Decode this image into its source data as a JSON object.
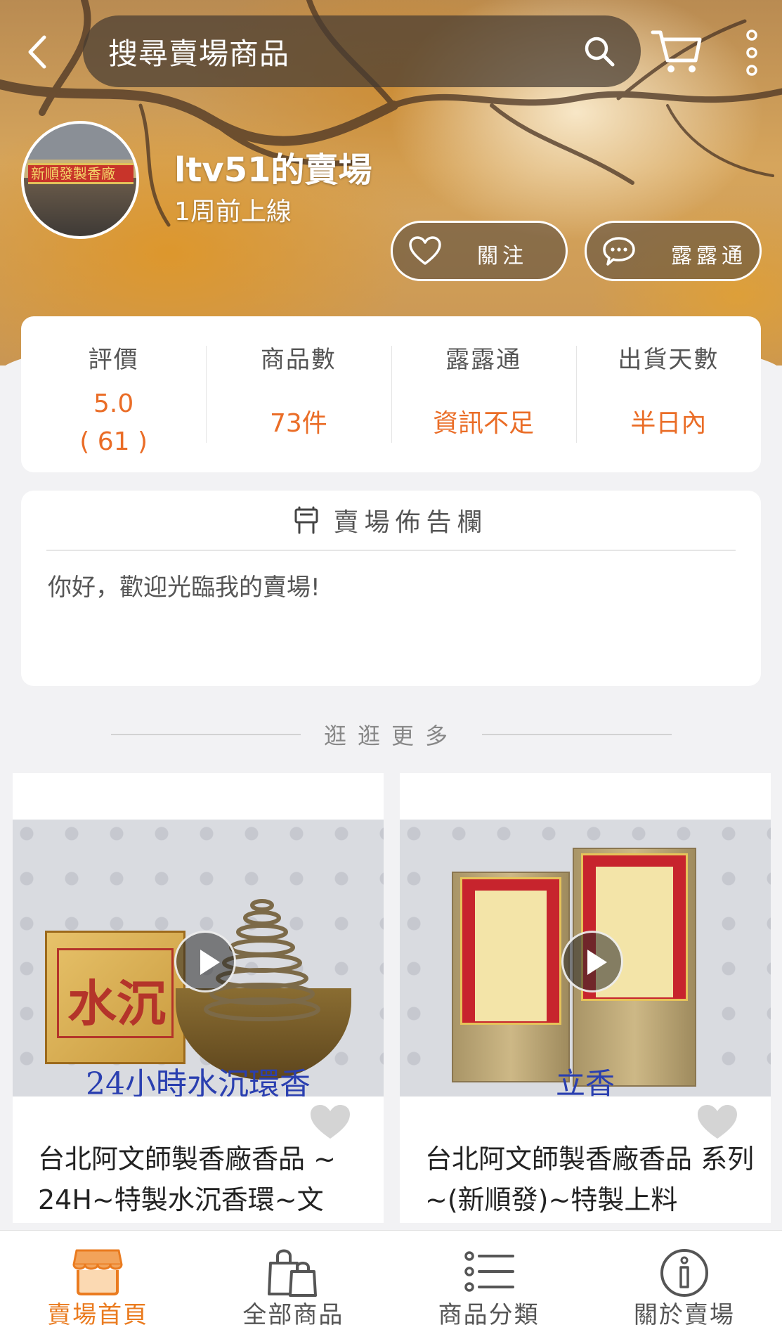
{
  "search": {
    "placeholder": "搜尋賣場商品"
  },
  "icons": {
    "back": "chevron-left-icon",
    "search": "search-icon",
    "cart": "cart-icon",
    "more": "more-vertical-icon"
  },
  "shop": {
    "name": "ltv51的賣場",
    "online_status": "1周前上線",
    "avatar_sign": "新順發製香廠",
    "follow_label": "關注",
    "chat_label": "露露通"
  },
  "stats": [
    {
      "label": "評價",
      "value": "5.0",
      "value2": "( 61 )"
    },
    {
      "label": "商品數",
      "value": "73件"
    },
    {
      "label": "露露通",
      "value": "資訊不足"
    },
    {
      "label": "出貨天數",
      "value": "半日內"
    }
  ],
  "bulletin": {
    "title": "賣場佈告欄",
    "text": "你好，歡迎光臨我的賣場!"
  },
  "browse_more": "逛逛更多",
  "products": [
    {
      "image_box_text": "水沉",
      "image_caption": "24小時水沉環香",
      "title": "台北阿文師製香廠香品 ~ 24H~特製水沉香環~文"
    },
    {
      "image_caption": "立香",
      "title": "台北阿文師製香廠香品 系列~(新順發)~特製上料"
    }
  ],
  "nav": [
    {
      "label": "賣場首頁",
      "icon": "store-icon",
      "active": true
    },
    {
      "label": "全部商品",
      "icon": "shopping-bag-icon",
      "active": false
    },
    {
      "label": "商品分類",
      "icon": "list-icon",
      "active": false
    },
    {
      "label": "關於賣場",
      "icon": "info-icon",
      "active": false
    }
  ],
  "colors": {
    "accent": "#ea6d27",
    "nav_active": "#ea7b1f",
    "caption_blue": "#2a3fb0"
  }
}
